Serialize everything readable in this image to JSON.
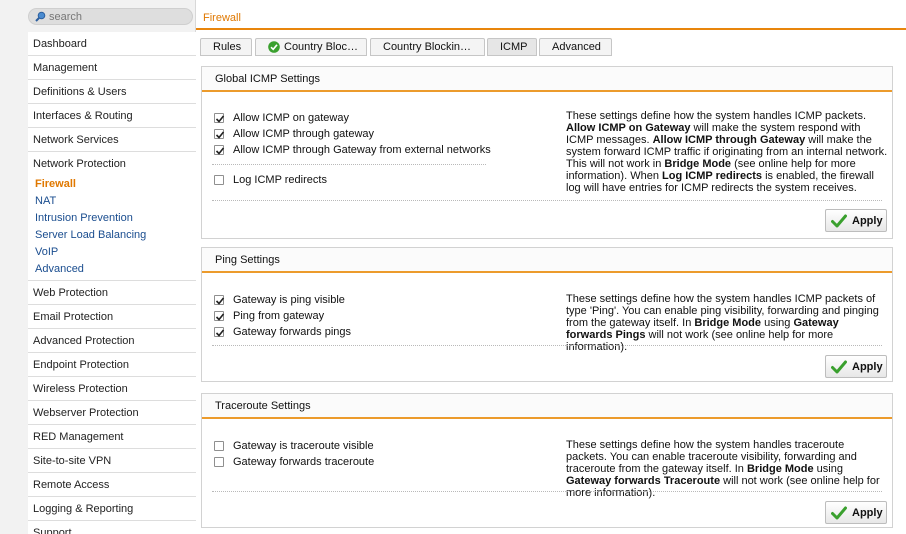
{
  "search": {
    "placeholder": "search"
  },
  "sidebar": {
    "items_top": [
      "Dashboard",
      "Management",
      "Definitions & Users",
      "Interfaces & Routing",
      "Network Services"
    ],
    "group": {
      "label": "Network Protection",
      "items": [
        "Firewall",
        "NAT",
        "Intrusion Prevention",
        "Server Load Balancing",
        "VoIP",
        "Advanced"
      ],
      "active": "Firewall"
    },
    "items_bottom": [
      "Web Protection",
      "Email Protection",
      "Advanced Protection",
      "Endpoint Protection",
      "Wireless Protection",
      "Webserver Protection",
      "RED Management",
      "Site-to-site VPN",
      "Remote Access",
      "Logging & Reporting",
      "Support"
    ]
  },
  "header": {
    "title": "Firewall"
  },
  "tabs": [
    {
      "label": "Rules"
    },
    {
      "label": "Country Bloc…",
      "icon": "check-circle-icon"
    },
    {
      "label": "Country Blockin…"
    },
    {
      "label": "ICMP",
      "active": true
    },
    {
      "label": "Advanced"
    }
  ],
  "colors": {
    "accent": "#e8850c",
    "link": "#1a4d8f",
    "check_green": "#3aa02e"
  },
  "global_icmp": {
    "title": "Global ICMP Settings",
    "options": [
      {
        "label": "Allow ICMP on gateway",
        "checked": true
      },
      {
        "label": "Allow ICMP through gateway",
        "checked": true
      },
      {
        "label": "Allow ICMP through Gateway from external networks",
        "checked": true
      },
      {
        "label": "Log ICMP redirects",
        "checked": false
      }
    ],
    "help": [
      "These settings define how the system handles ICMP packets.",
      "Allow ICMP on Gateway",
      " will make the system respond with ICMP messages. ",
      "Allow ICMP through Gateway",
      " will make the system forward ICMP traffic if originating from an internal network. This will not work in ",
      "Bridge Mode",
      " (see online help for more information).",
      "When ",
      "Log ICMP redirects",
      " is enabled, the firewall log will have entries for ICMP redirects the system receives."
    ],
    "apply_label": "Apply"
  },
  "ping": {
    "title": "Ping Settings",
    "options": [
      {
        "label": "Gateway is ping visible",
        "checked": true
      },
      {
        "label": "Ping from gateway",
        "checked": true
      },
      {
        "label": "Gateway forwards pings",
        "checked": true
      }
    ],
    "help": [
      "These settings define how the system handles ICMP packets of type 'Ping'. You can enable ping visibility, forwarding and pinging from the gateway itself. In ",
      "Bridge Mode",
      " using ",
      "Gateway forwards Pings",
      " will not work (see online help for more information)."
    ],
    "apply_label": "Apply"
  },
  "traceroute": {
    "title": "Traceroute Settings",
    "options": [
      {
        "label": "Gateway is traceroute visible",
        "checked": false
      },
      {
        "label": "Gateway forwards traceroute",
        "checked": false
      }
    ],
    "help": [
      "These settings define how the system handles traceroute packets. You can enable traceroute visibility, forwarding and traceroute from the gateway itself. In ",
      "Bridge Mode",
      " using ",
      "Gateway forwards Traceroute",
      " will not work (see online help for more information)."
    ],
    "apply_label": "Apply"
  }
}
